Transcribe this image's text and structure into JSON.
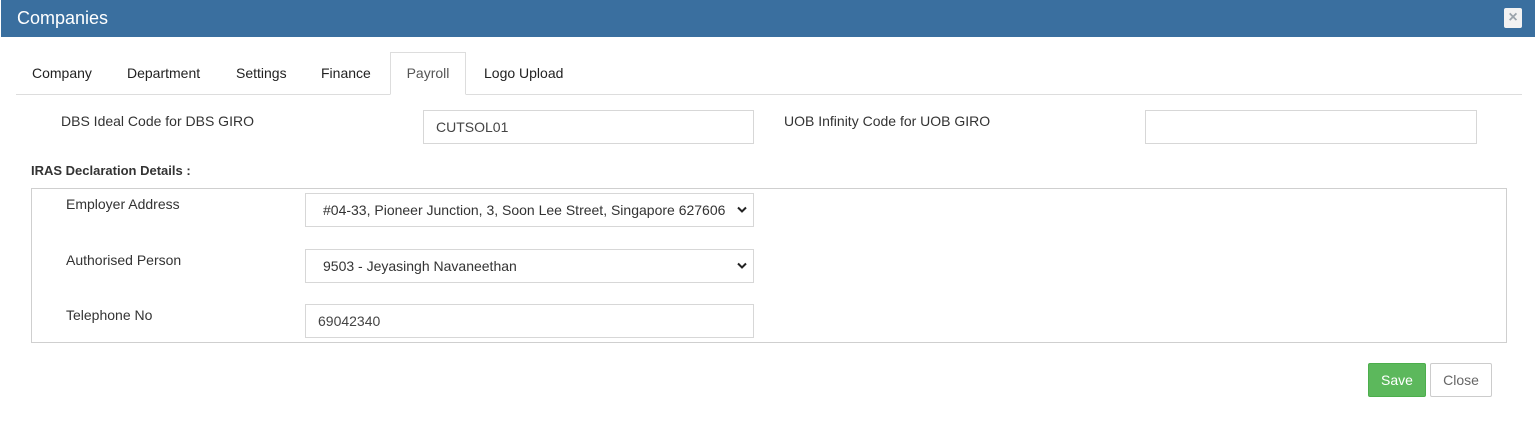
{
  "modal": {
    "title": "Companies",
    "close_icon_glyph": "×"
  },
  "tabs": [
    {
      "label": "Company",
      "active": false
    },
    {
      "label": "Department",
      "active": false
    },
    {
      "label": "Settings",
      "active": false
    },
    {
      "label": "Finance",
      "active": false
    },
    {
      "label": "Payroll",
      "active": true
    },
    {
      "label": "Logo Upload",
      "active": false
    }
  ],
  "payroll": {
    "dbs_label": "DBS Ideal Code for DBS GIRO",
    "dbs_value": "CUTSOL01",
    "uob_label": "UOB Infinity Code for UOB GIRO",
    "uob_value": "",
    "iras_heading": "IRAS Declaration Details :",
    "employer_address_label": "Employer Address",
    "employer_address_value": "#04-33, Pioneer Junction, 3, Soon Lee Street, Singapore 627606",
    "authorised_person_label": "Authorised Person",
    "authorised_person_value": "9503 - Jeyasingh Navaneethan",
    "telephone_label": "Telephone No",
    "telephone_value": "69042340"
  },
  "footer": {
    "save_label": "Save",
    "close_label": "Close"
  },
  "colors": {
    "header_bg": "#3a6f9f",
    "save_bg": "#5cb85c"
  }
}
